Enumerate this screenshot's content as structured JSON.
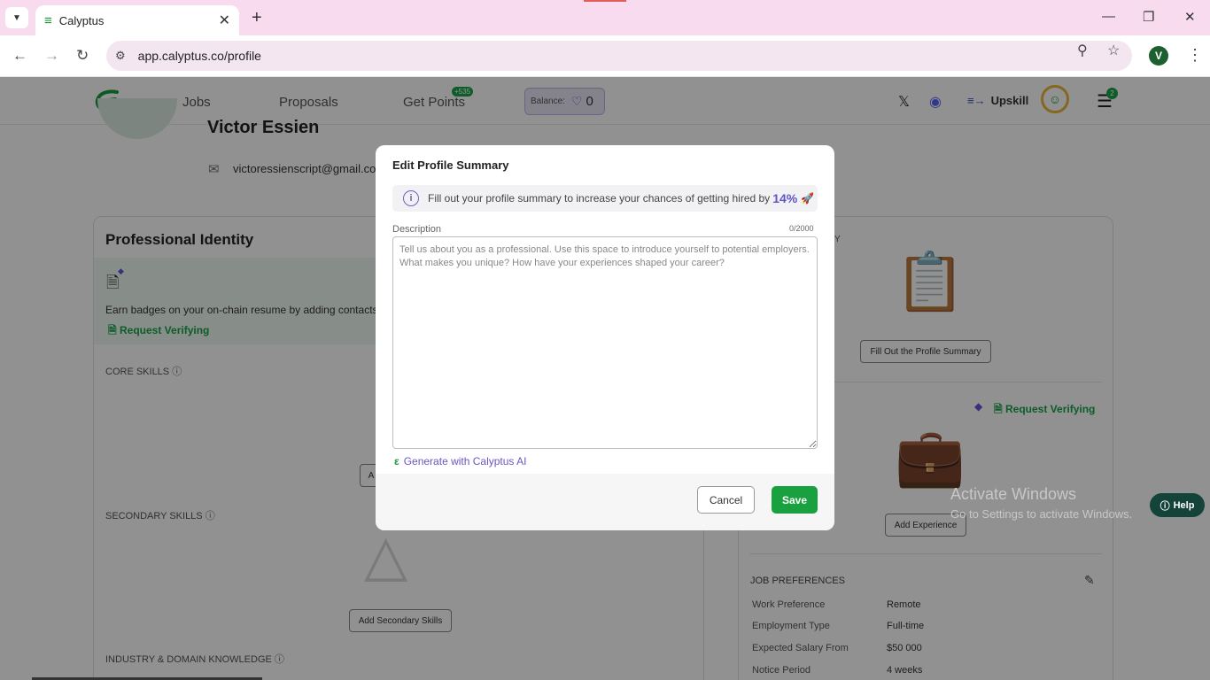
{
  "browser": {
    "tab_title": "Calyptus",
    "url": "app.calyptus.co/profile",
    "profile_initial": "V"
  },
  "header": {
    "nav": [
      "Jobs",
      "Proposals",
      "Get Points"
    ],
    "points_badge": "+535",
    "balance_label": "Balance:",
    "balance_value": "0",
    "upskill_label": "Upskill",
    "notifications_count": "2"
  },
  "profile": {
    "name": "Victor Essien",
    "email": "victoressienscript@gmail.com"
  },
  "left_card": {
    "title": "Professional Identity",
    "banner_text": "Earn badges on your on-chain resume by adding contacts w",
    "request_verifying": "Request Verifying",
    "core_skills": "CORE SKILLS",
    "core_button_fragment": "A",
    "secondary_skills": "SECONDARY SKILLS",
    "add_secondary": "Add Secondary Skills",
    "industry": "INDUSTRY & DOMAIN KNOWLEDGE"
  },
  "right_card": {
    "summary_label_fragment": "Y",
    "fill_summary_button": "Fill Out the Profile Summary",
    "request_verifying": "Request Verifying",
    "add_experience": "Add Experience",
    "job_prefs_title": "JOB PREFERENCES",
    "job_prefs": [
      {
        "k": "Work Preference",
        "v": "Remote"
      },
      {
        "k": "Employment Type",
        "v": "Full-time"
      },
      {
        "k": "Expected Salary From",
        "v": "$50 000"
      },
      {
        "k": "Notice Period",
        "v": "4 weeks"
      }
    ]
  },
  "modal": {
    "title": "Edit Profile Summary",
    "tip_text": "Fill out your profile summary to increase your chances of getting hired by",
    "tip_percent": "14%",
    "description_label": "Description",
    "counter": "0/2000",
    "placeholder": "Tell us about you as a professional. Use this space to introduce yourself to potential employers. What makes you unique? How have your experiences shaped your career?",
    "generate_label": "Generate with Calyptus AI",
    "cancel": "Cancel",
    "save": "Save"
  },
  "watermark": {
    "line1": "Activate Windows",
    "line2": "Go to Settings to activate Windows."
  },
  "help_label": "Help",
  "colors": {
    "brand_green": "#1aa13f",
    "accent_purple": "#5d55c8",
    "overlay": "rgba(0,0,0,0.43)"
  }
}
